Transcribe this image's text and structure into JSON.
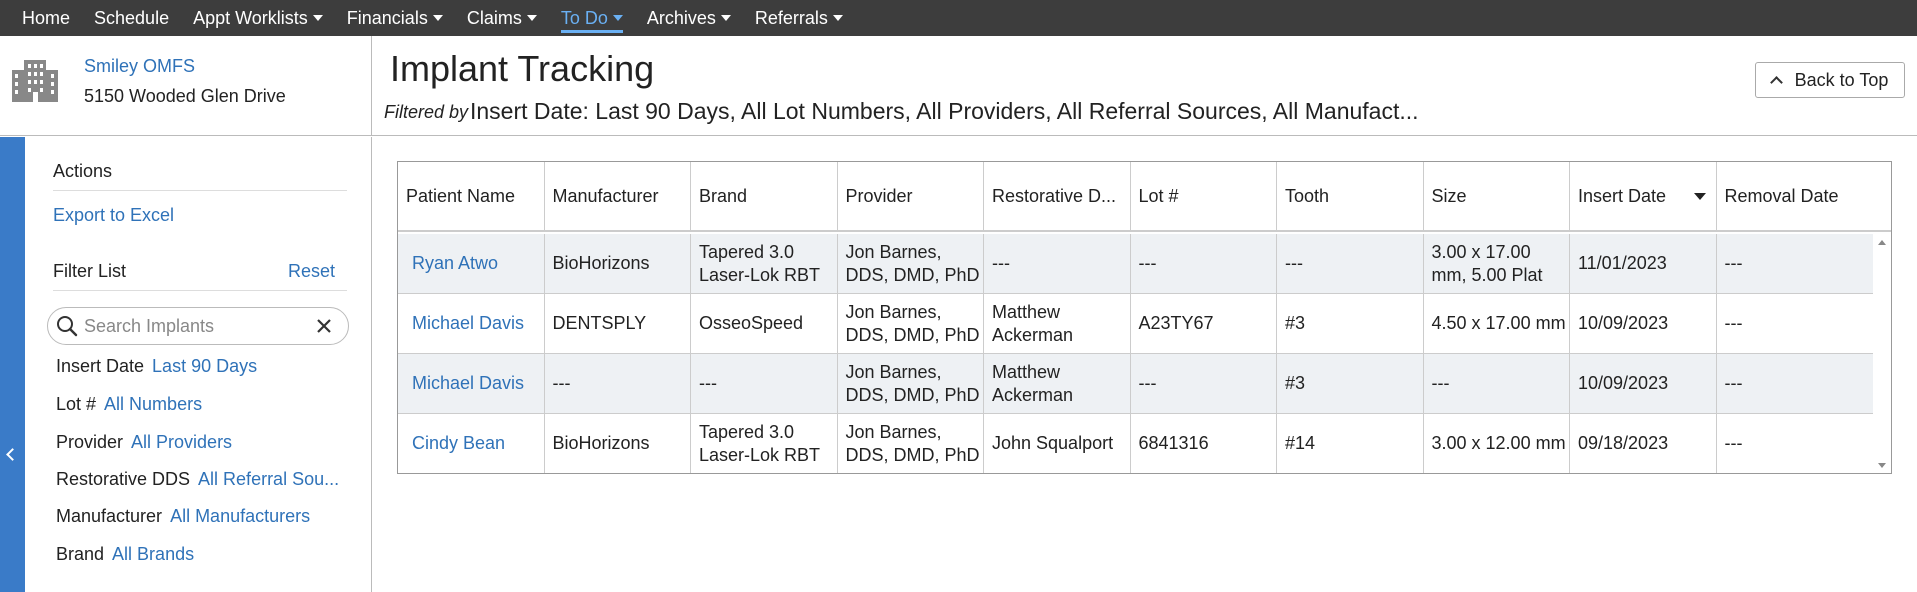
{
  "nav": {
    "items": [
      {
        "label": "Home",
        "dropdown": false,
        "active": false
      },
      {
        "label": "Schedule",
        "dropdown": false,
        "active": false
      },
      {
        "label": "Appt Worklists",
        "dropdown": true,
        "active": false
      },
      {
        "label": "Financials",
        "dropdown": true,
        "active": false
      },
      {
        "label": "Claims",
        "dropdown": true,
        "active": false
      },
      {
        "label": "To Do",
        "dropdown": true,
        "active": true
      },
      {
        "label": "Archives",
        "dropdown": true,
        "active": false
      },
      {
        "label": "Referrals",
        "dropdown": true,
        "active": false
      }
    ]
  },
  "practice": {
    "icon": "building-icon",
    "name": "Smiley OMFS",
    "address": "5150 Wooded Glen Drive"
  },
  "header": {
    "title": "Implant Tracking",
    "filtered_by_label": "Filtered by",
    "filter_summary": "Insert Date: Last 90 Days, All Lot Numbers, All Providers, All Referral Sources, All Manufact...",
    "back_to_top": "Back to Top"
  },
  "sidebar": {
    "actions_title": "Actions",
    "export_label": "Export to Excel",
    "filter_list_title": "Filter List",
    "reset_label": "Reset",
    "search_placeholder": "Search Implants",
    "filters": [
      {
        "label": "Insert Date",
        "value": "Last 90 Days"
      },
      {
        "label": "Lot #",
        "value": "All Numbers"
      },
      {
        "label": "Provider",
        "value": "All Providers"
      },
      {
        "label": "Restorative DDS",
        "value": "All Referral Sou..."
      },
      {
        "label": "Manufacturer",
        "value": "All Manufacturers"
      },
      {
        "label": "Brand",
        "value": "All Brands"
      }
    ]
  },
  "table": {
    "columns": [
      "Patient Name",
      "Manufacturer",
      "Brand",
      "Provider",
      "Restorative D...",
      "Lot #",
      "Tooth",
      "Size",
      "Insert Date",
      "Removal Date"
    ],
    "sorted_column": "Insert Date",
    "rows": [
      [
        "Ryan Atwo",
        "BioHorizons",
        "Tapered 3.0 Laser-Lok RBT",
        "Jon Barnes, DDS, DMD, PhD",
        "---",
        "---",
        "---",
        "3.00 x 17.00 mm, 5.00 Plat",
        "11/01/2023",
        "---"
      ],
      [
        "Michael Davis",
        "DENTSPLY",
        "OsseoSpeed",
        "Jon Barnes, DDS, DMD, PhD",
        "Matthew Ackerman",
        "A23TY67",
        "#3",
        "4.50 x 17.00 mm",
        "10/09/2023",
        "---"
      ],
      [
        "Michael Davis",
        "---",
        "---",
        "Jon Barnes, DDS, DMD, PhD",
        "Matthew Ackerman",
        "---",
        "#3",
        "---",
        "10/09/2023",
        "---"
      ],
      [
        "Cindy Bean",
        "BioHorizons",
        "Tapered 3.0 Laser-Lok RBT",
        "Jon Barnes, DDS, DMD, PhD",
        "John Squalport",
        "6841316",
        "#14",
        "3.00 x 12.00 mm",
        "09/18/2023",
        "---"
      ]
    ]
  },
  "colors": {
    "nav_bg": "#3d3d3d",
    "link": "#2f72b8",
    "active_nav": "#6ab0f3",
    "sidebar_tab": "#3a7bc8",
    "row_alt": "#eef1f4"
  }
}
